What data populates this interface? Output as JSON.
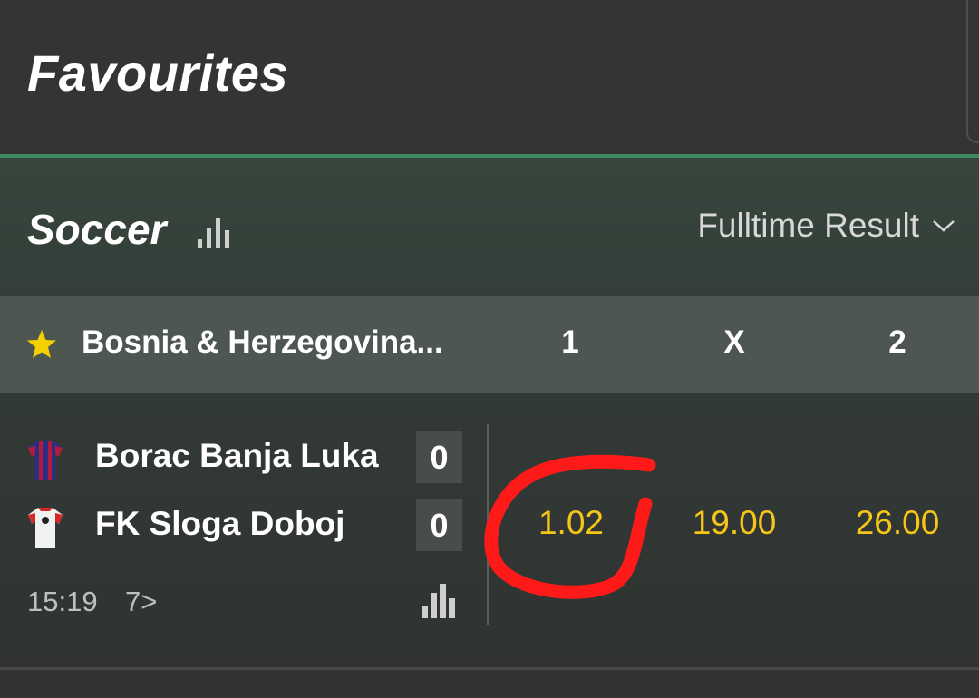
{
  "header": {
    "title": "Favourites"
  },
  "section": {
    "sport": "Soccer",
    "market": "Fulltime Result"
  },
  "league": {
    "name": "Bosnia & Herzegovina...",
    "columns": [
      "1",
      "X",
      "2"
    ]
  },
  "match": {
    "home": {
      "name": "Borac Banja Luka",
      "score": "0"
    },
    "away": {
      "name": "FK Sloga Doboj",
      "score": "0"
    },
    "time": "15:19",
    "more_markets": "7>",
    "odds": [
      "1.02",
      "19.00",
      "26.00"
    ]
  },
  "colors": {
    "accent_green": "#3f8a5e",
    "odds_yellow": "#f5c518",
    "annotation_red": "#ff1a1a",
    "star": "#f5d000"
  },
  "icons": [
    "stats-icon",
    "chevron-down-icon",
    "star-icon",
    "jersey-icon"
  ]
}
